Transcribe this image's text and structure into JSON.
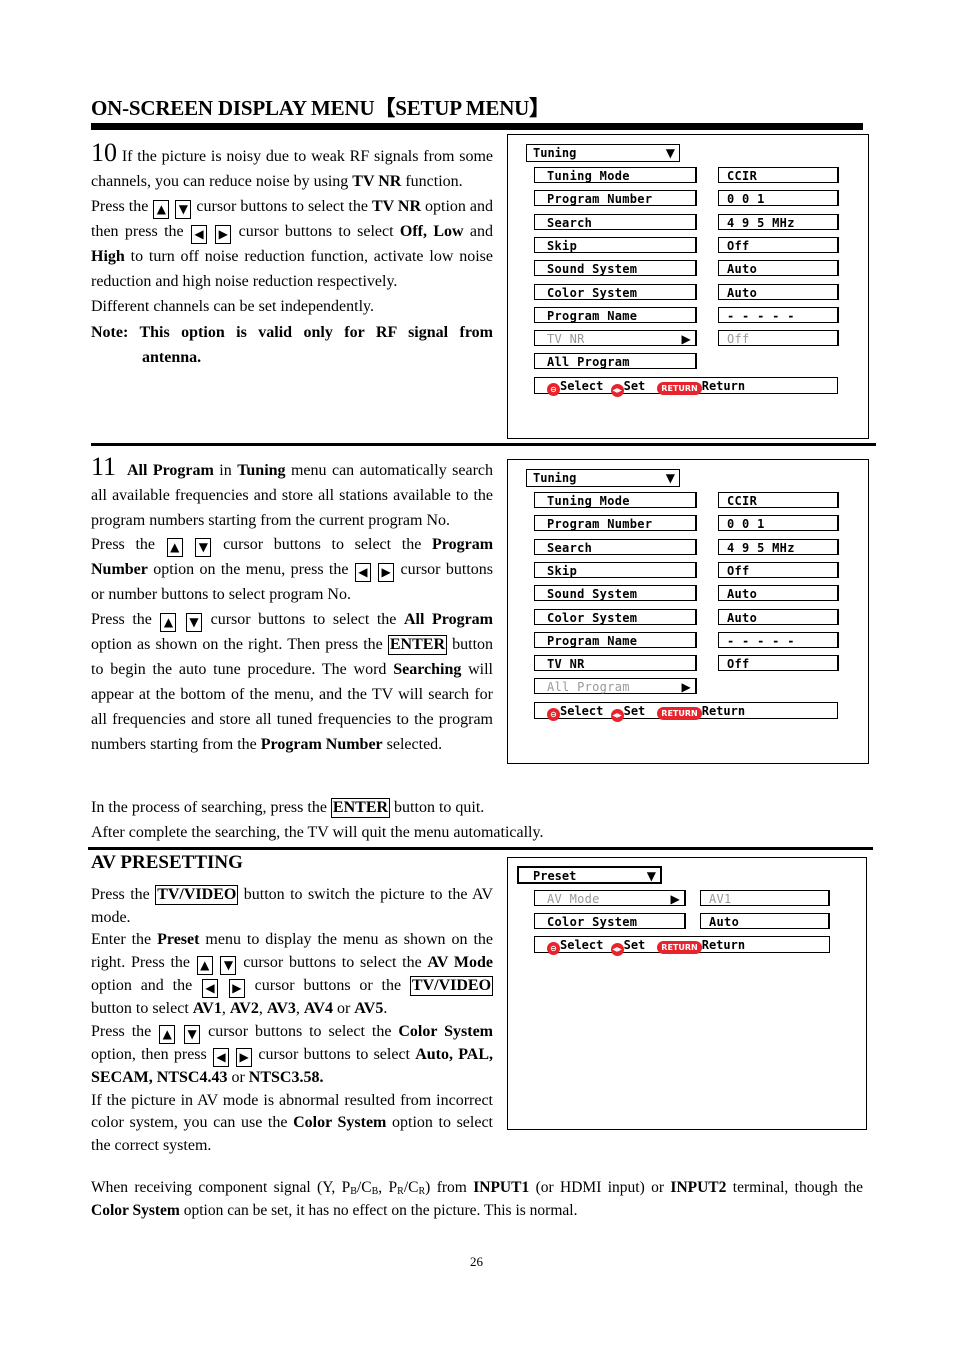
{
  "page": {
    "title": "ON-SCREEN DISPLAY MENU【SETUP MENU】",
    "page_number": "26"
  },
  "sec10": {
    "number": "10",
    "p1a": " If the picture is noisy due to weak RF signals from some channels, you can reduce noise by using ",
    "p1b": "TV NR",
    "p1c": " function.",
    "p2a": "Press the ",
    "p2b": " cursor buttons to select the ",
    "p2c": "TV NR",
    "p2d": " option and then press the ",
    "p2e": " cursor buttons to select ",
    "p2f": "Off",
    "p2g": ", ",
    "p2h": "Low",
    "p2i": " and ",
    "p2j": "High",
    "p2k": " to turn off noise reduction function, activate low noise reduction and high noise reduction respectively.",
    "p3": "Different channels can be set independently.",
    "note1": "Note: This option is valid only for RF signal from",
    "note2": "antenna."
  },
  "sec11": {
    "number": "11",
    "a1": "All Program",
    "a2": " in ",
    "a3": "Tuning",
    "a4": " menu can automatically search all available frequencies and store all stations available to the program numbers starting from the current program No.",
    "b1": "Press the ",
    "b2": " cursor buttons to select the ",
    "b3": "Program Number",
    "b4": " option on the menu, press the ",
    "b5": " cursor buttons or number buttons to select program No.",
    "c1": "Press the ",
    "c2": " cursor buttons to select the ",
    "c3": "All Program",
    "c4": " option as shown on the right. Then press the ",
    "c5": "ENTER",
    "c6": " button to begin the auto tune procedure. The word ",
    "c7": "Searching",
    "c8": " will appear at the bottom of the menu, and the TV will search for all frequencies and store all tuned frequencies to the program numbers starting from the ",
    "c9": "Program Number",
    "c10": " selected.",
    "d1": "In the process of searching, press the ",
    "d2": "ENTER",
    "d3": " button to quit.",
    "e1": "After complete the searching, the TV will quit the menu automatically."
  },
  "av": {
    "heading": "AV PRESETTING",
    "a1": "Press the ",
    "a2": "TV/VIDEO",
    "a3": " button to switch the picture to the AV mode.",
    "b1": "Enter the ",
    "b2": "Preset",
    "b3": " menu to display the menu as shown on the right. Press the ",
    "b4": " cursor buttons to select the ",
    "b5": "AV Mode",
    "b6": " option and the ",
    "b7": " cursor buttons or the ",
    "b8": "TV/VIDEO",
    "b9": " button to select ",
    "b10": "AV1",
    "b11": ", ",
    "b12": "AV2",
    "b13": ", ",
    "b14": "AV3",
    "b15": ", ",
    "b16": "AV4",
    "b17": " or ",
    "b18": "AV5",
    "b19": ".",
    "c1": "Press the ",
    "c2": " cursor buttons to select the ",
    "c3": "Color System",
    "c4": " option, then press ",
    "c5": " cursor buttons to select ",
    "c6": "Auto",
    "c7": ", ",
    "c8": "PAL",
    "c9": ", ",
    "c10": "SECAM",
    "c11": ", ",
    "c12": "NTSC4.43",
    "c13": " or ",
    "c14": "NTSC3.58.",
    "d1": "If the picture in AV mode is abnormal resulted from incorrect color system, you can use the ",
    "d2": "Color System",
    "d3": " option to select the correct system.",
    "e1": "When receiving component signal (Y, P",
    "e_sub1": "B",
    "e2": "/C",
    "e_sub2": "B",
    "e3": ", P",
    "e_sub3": "R",
    "e4": "/C",
    "e_sub4": "R",
    "e5": ") from ",
    "e6": "INPUT1",
    "e7": " (or HDMI input) or ",
    "e8": "INPUT2",
    "e9": " terminal, though the ",
    "e10": "Color System",
    "e11": " option can be set, it has no effect on the picture. This is normal."
  },
  "keys": {
    "up": "▲",
    "down": "▼",
    "left": "◀",
    "right": "▶"
  },
  "menu1": {
    "header": "Tuning",
    "rows": [
      {
        "label": "Tuning Mode",
        "value": "CCIR"
      },
      {
        "label": "Program Number",
        "value": "0 0 1"
      },
      {
        "label": "Search",
        "value": "4 9 5 MHz"
      },
      {
        "label": "Skip",
        "value": "Off"
      },
      {
        "label": "Sound System",
        "value": "Auto"
      },
      {
        "label": "Color System",
        "value": "Auto"
      },
      {
        "label": "Program Name",
        "value": "- - - - -"
      },
      {
        "label": "TV NR",
        "value": "Off"
      },
      {
        "label": "All Program",
        "value": ""
      }
    ],
    "highlighted": "TV NR"
  },
  "menu2": {
    "header": "Tuning",
    "rows": [
      {
        "label": "Tuning Mode",
        "value": "CCIR"
      },
      {
        "label": "Program Number",
        "value": "0 0 1"
      },
      {
        "label": "Search",
        "value": "4 9 5 MHz"
      },
      {
        "label": "Skip",
        "value": "Off"
      },
      {
        "label": "Sound System",
        "value": "Auto"
      },
      {
        "label": "Color System",
        "value": "Auto"
      },
      {
        "label": "Program Name",
        "value": "- - - - -"
      },
      {
        "label": "TV NR",
        "value": "Off"
      },
      {
        "label": "All Program",
        "value": ""
      }
    ],
    "highlighted": "All Program"
  },
  "menu3": {
    "header": "Preset",
    "rows": [
      {
        "label": "AV Mode",
        "value": "AV1"
      },
      {
        "label": "Color System",
        "value": "Auto"
      }
    ],
    "highlighted": "AV Mode"
  },
  "footer": {
    "select_icon": "⊖",
    "select": "Select",
    "set_icon": "◀▶",
    "set": "Set",
    "return_badge": "RETURN",
    "return": "Return"
  },
  "colors": {
    "accent_red": "#e8232b",
    "dim_text": "#999999"
  }
}
